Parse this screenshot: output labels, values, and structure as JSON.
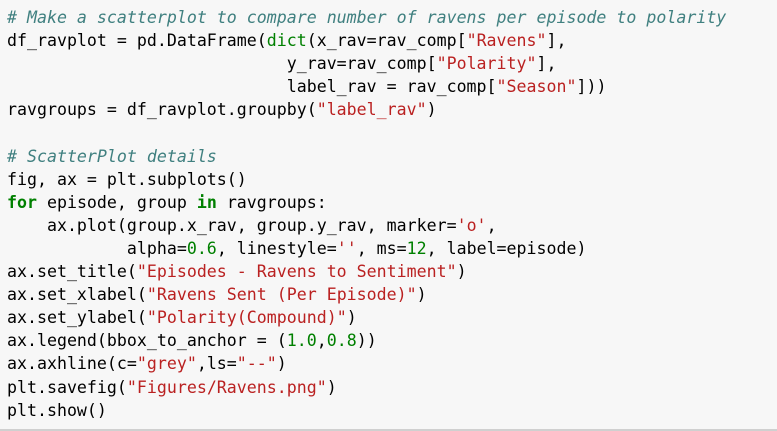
{
  "colors": {
    "background": "#f7f7f7",
    "comment": "#408080",
    "string": "#ba2121",
    "number": "#008000",
    "keyword": "#008000",
    "builtin": "#008000",
    "default": "#000000"
  },
  "lines": [
    [
      {
        "t": "c",
        "v": "# Make a scatterplot to compare number of ravens per episode to polarity"
      }
    ],
    [
      {
        "t": "d",
        "v": "df_ravplot = pd.DataFrame("
      },
      {
        "t": "b",
        "v": "dict"
      },
      {
        "t": "d",
        "v": "(x_rav=rav_comp["
      },
      {
        "t": "s",
        "v": "\"Ravens\""
      },
      {
        "t": "d",
        "v": "],"
      }
    ],
    [
      {
        "t": "d",
        "v": "                            y_rav=rav_comp["
      },
      {
        "t": "s",
        "v": "\"Polarity\""
      },
      {
        "t": "d",
        "v": "],"
      }
    ],
    [
      {
        "t": "d",
        "v": "                            label_rav = rav_comp["
      },
      {
        "t": "s",
        "v": "\"Season\""
      },
      {
        "t": "d",
        "v": "]))"
      }
    ],
    [
      {
        "t": "d",
        "v": "ravgroups = df_ravplot.groupby("
      },
      {
        "t": "s",
        "v": "\"label_rav\""
      },
      {
        "t": "d",
        "v": ")"
      }
    ],
    [
      {
        "t": "d",
        "v": ""
      }
    ],
    [
      {
        "t": "c",
        "v": "# ScatterPlot details"
      }
    ],
    [
      {
        "t": "d",
        "v": "fig, ax = plt.subplots()"
      }
    ],
    [
      {
        "t": "k",
        "v": "for"
      },
      {
        "t": "d",
        "v": " episode, group "
      },
      {
        "t": "k",
        "v": "in"
      },
      {
        "t": "d",
        "v": " ravgroups:"
      }
    ],
    [
      {
        "t": "d",
        "v": "    ax.plot(group.x_rav, group.y_rav, marker="
      },
      {
        "t": "s",
        "v": "'o'"
      },
      {
        "t": "d",
        "v": ","
      }
    ],
    [
      {
        "t": "d",
        "v": "            alpha="
      },
      {
        "t": "n",
        "v": "0.6"
      },
      {
        "t": "d",
        "v": ", linestyle="
      },
      {
        "t": "s",
        "v": "''"
      },
      {
        "t": "d",
        "v": ", ms="
      },
      {
        "t": "n",
        "v": "12"
      },
      {
        "t": "d",
        "v": ", label=episode)"
      }
    ],
    [
      {
        "t": "d",
        "v": "ax.set_title("
      },
      {
        "t": "s",
        "v": "\"Episodes - Ravens to Sentiment\""
      },
      {
        "t": "d",
        "v": ")"
      }
    ],
    [
      {
        "t": "d",
        "v": "ax.set_xlabel("
      },
      {
        "t": "s",
        "v": "\"Ravens Sent (Per Episode)\""
      },
      {
        "t": "d",
        "v": ")"
      }
    ],
    [
      {
        "t": "d",
        "v": "ax.set_ylabel("
      },
      {
        "t": "s",
        "v": "\"Polarity(Compound)\""
      },
      {
        "t": "d",
        "v": ")"
      }
    ],
    [
      {
        "t": "d",
        "v": "ax.legend(bbox_to_anchor = ("
      },
      {
        "t": "n",
        "v": "1.0"
      },
      {
        "t": "d",
        "v": ","
      },
      {
        "t": "n",
        "v": "0.8"
      },
      {
        "t": "d",
        "v": "))"
      }
    ],
    [
      {
        "t": "d",
        "v": "ax.axhline(c="
      },
      {
        "t": "s",
        "v": "\"grey\""
      },
      {
        "t": "d",
        "v": ",ls="
      },
      {
        "t": "s",
        "v": "\"--\""
      },
      {
        "t": "d",
        "v": ")"
      }
    ],
    [
      {
        "t": "d",
        "v": "plt.savefig("
      },
      {
        "t": "s",
        "v": "\"Figures/Ravens.png\""
      },
      {
        "t": "d",
        "v": ")"
      }
    ],
    [
      {
        "t": "d",
        "v": "plt.show()"
      }
    ]
  ]
}
